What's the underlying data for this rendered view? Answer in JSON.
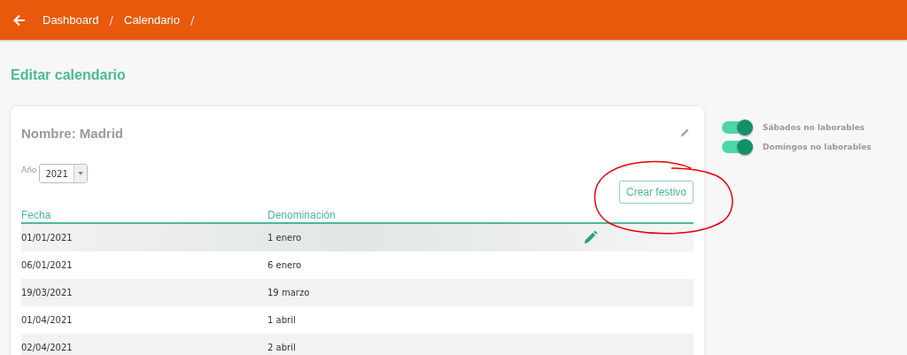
{
  "breadcrumb": [
    {
      "label": "Dashboard",
      "separator": "/"
    },
    {
      "label": "Calendario",
      "separator": "/"
    }
  ],
  "page_title": "Editar calendario",
  "calendar": {
    "name": "Nombre: Madrid",
    "year_label": "Año",
    "year": "2021",
    "create_button": "Crear festivo"
  },
  "table": {
    "columns": [
      "Fecha",
      "Denominación"
    ],
    "rows": [
      {
        "date": "01/01/2021",
        "name": "1 enero",
        "hovered": true
      },
      {
        "date": "06/01/2021",
        "name": "6 enero",
        "hovered": false
      },
      {
        "date": "19/03/2021",
        "name": "19 marzo",
        "hovered": false
      },
      {
        "date": "01/04/2021",
        "name": "1 abril",
        "hovered": false
      },
      {
        "date": "02/04/2021",
        "name": "2 abril",
        "hovered": false
      }
    ]
  },
  "toggles": [
    {
      "label": "Sábados no laborables",
      "on": true
    },
    {
      "label": "Domingos no laborables",
      "on": true
    }
  ]
}
